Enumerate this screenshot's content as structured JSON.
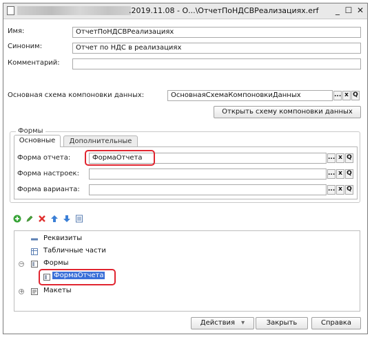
{
  "window": {
    "title": ".2019.11.08 - О...\\ОтчетПоНДСВРеализациях.erf",
    "minimize": "_",
    "maximize": "☐",
    "close": "✕"
  },
  "fields": {
    "name_label": "Имя:",
    "name_value": "ОтчетПоНДСВРеализациях",
    "synonym_label": "Синоним:",
    "synonym_value": "Отчет по НДС в реализациях",
    "comment_label": "Комментарий:",
    "comment_value": "",
    "scheme_label": "Основная схема компоновки данных:",
    "scheme_value": "ОсновнаяСхемаКомпоновкиДанных"
  },
  "buttons": {
    "ellipsis": "...",
    "clear": "x",
    "open": "Q",
    "open_scheme": "Открыть схему компоновки данных",
    "actions": "Действия",
    "actions_arrow": "▾",
    "close": "Закрыть",
    "help": "Справка"
  },
  "forms_group": {
    "title": "Формы",
    "tabs": [
      {
        "label": "Основные",
        "active": true
      },
      {
        "label": "Дополнительные",
        "active": false
      }
    ],
    "report_form_label": "Форма отчета:",
    "report_form_value": "ФормаОтчета",
    "settings_form_label": "Форма настроек:",
    "settings_form_value": "",
    "variant_form_label": "Форма варианта:",
    "variant_form_value": ""
  },
  "toolbar_icons": [
    "add-icon",
    "edit-icon",
    "delete-icon",
    "move-up-icon",
    "move-down-icon",
    "list-icon"
  ],
  "tree": {
    "items": [
      {
        "label": "Реквизиты",
        "icon": "attribute-icon"
      },
      {
        "label": "Табличные части",
        "icon": "table-icon"
      },
      {
        "label": "Формы",
        "icon": "forms-icon",
        "expanded": true
      },
      {
        "label": "ФормаОтчета",
        "icon": "form-icon",
        "selected": true
      },
      {
        "label": "Макеты",
        "icon": "template-icon",
        "expanded": false
      }
    ],
    "expander_open": "⊖",
    "expander_closed": "⊕"
  },
  "colors": {
    "highlight": "#e0242f",
    "selection": "#3a6fd8"
  }
}
